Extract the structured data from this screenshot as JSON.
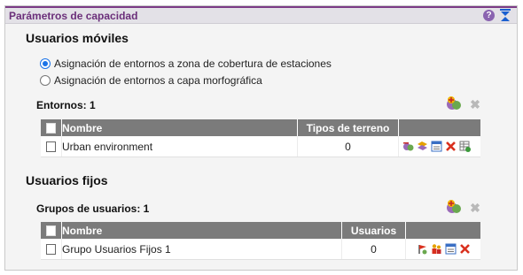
{
  "panel": {
    "title": "Parámetros de capacidad",
    "help_symbol": "?",
    "accent": "#7b3b86"
  },
  "mobile": {
    "title": "Usuarios móviles",
    "options": [
      {
        "label": "Asignación de entornos a zona de cobertura de estaciones",
        "selected": true
      },
      {
        "label": "Asignación de entornos a capa morfográfica",
        "selected": false
      }
    ],
    "count_label": "Entornos: 1",
    "columns": {
      "name": "Nombre",
      "terrain": "Tipos de terreno"
    },
    "rows": [
      {
        "name": "Urban environment",
        "terrain": "0"
      }
    ]
  },
  "fixed": {
    "title": "Usuarios fijos",
    "count_label": "Grupos de usuarios: 1",
    "columns": {
      "name": "Nombre",
      "users": "Usuarios"
    },
    "rows": [
      {
        "name": "Grupo Usuarios Fijos 1",
        "users": "0"
      }
    ]
  },
  "icons": {
    "add": "add-group-icon",
    "delete": "delete-icon",
    "delete_symbol": "✖"
  }
}
